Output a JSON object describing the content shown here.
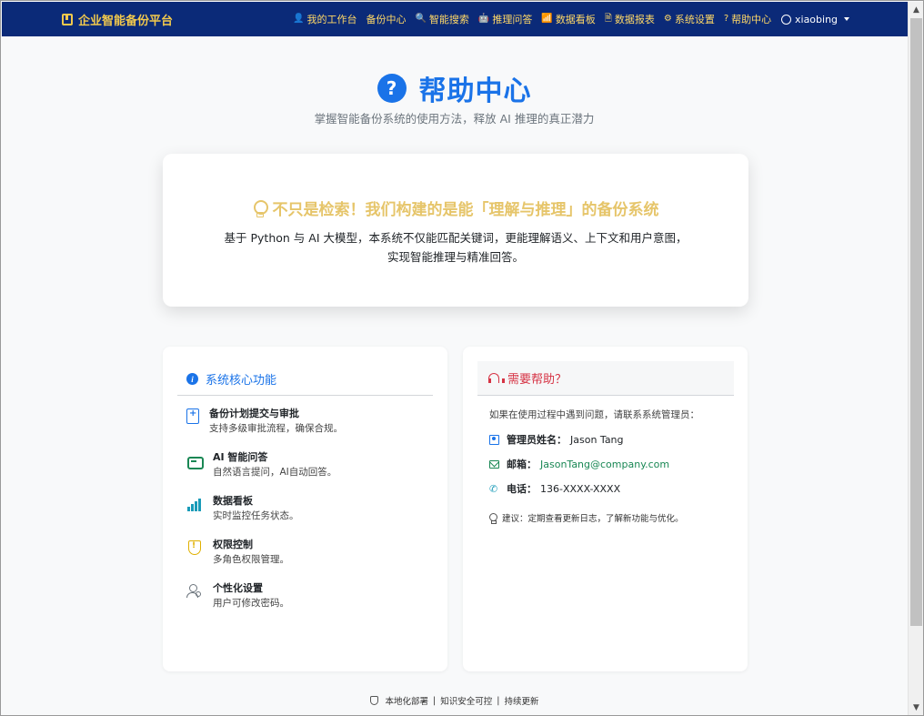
{
  "navbar": {
    "brand": "企业智能备份平台",
    "items": [
      {
        "icon": "user-icon",
        "glyph": "👤",
        "label": "我的工作台"
      },
      {
        "icon": "none",
        "glyph": "",
        "label": "备份中心"
      },
      {
        "icon": "search-icon",
        "glyph": "🔍",
        "label": "智能搜索"
      },
      {
        "icon": "robot-icon",
        "glyph": "🤖",
        "label": "推理问答"
      },
      {
        "icon": "bar-chart-icon",
        "glyph": "📶",
        "label": "数据看板"
      },
      {
        "icon": "report-icon",
        "glyph": "🗎",
        "label": "数据报表"
      },
      {
        "icon": "gear-icon",
        "glyph": "⚙",
        "label": "系统设置"
      },
      {
        "icon": "question-icon",
        "glyph": "?",
        "label": "帮助中心"
      }
    ],
    "user": "xiaobing"
  },
  "header": {
    "icon_glyph": "?",
    "title": "帮助中心",
    "subtitle": "掌握智能备份系统的使用方法，释放 AI 推理的真正潜力"
  },
  "hero": {
    "headline": "不只是检索！我们构建的是能「理解与推理」的备份系统",
    "desc_line1": "基于 Python 与 AI 大模型，本系统不仅能匹配关键词，更能理解语义、上下文和用户意图，",
    "desc_line2": "实现智能推理与精准回答。"
  },
  "features": {
    "title": "系统核心功能",
    "items": [
      {
        "icon": "clipboard-plus-icon",
        "title": "备份计划提交与审批",
        "desc": "支持多级审批流程，确保合规。"
      },
      {
        "icon": "robot-icon",
        "title": "AI 智能问答",
        "desc": "自然语言提问，AI自动回答。"
      },
      {
        "icon": "bar-chart-icon",
        "title": "数据看板",
        "desc": "实时监控任务状态。"
      },
      {
        "icon": "shield-icon",
        "title": "权限控制",
        "desc": "多角色权限管理。"
      },
      {
        "icon": "user-gear-icon",
        "title": "个性化设置",
        "desc": "用户可修改密码。"
      }
    ]
  },
  "contact": {
    "title": "需要帮助？",
    "intro": "如果在使用过程中遇到问题，请联系系统管理员：",
    "admin_label": "管理员姓名：",
    "admin_name": "Jason Tang",
    "email_label": "邮箱：",
    "email": "JasonTang@company.com",
    "phone_label": "电话：",
    "phone": "136-XXXX-XXXX",
    "tip": "建议：定期查看更新日志，了解新功能与优化。"
  },
  "footer": {
    "items": [
      "本地化部署",
      "知识安全可控",
      "持续更新"
    ]
  },
  "colors": {
    "navbar_bg": "#0b2a78",
    "nav_text": "#ffd866",
    "accent_blue": "#1a73e8",
    "hero_gold": "#e6c56a",
    "help_red": "#d63344",
    "email_green": "#198754"
  }
}
